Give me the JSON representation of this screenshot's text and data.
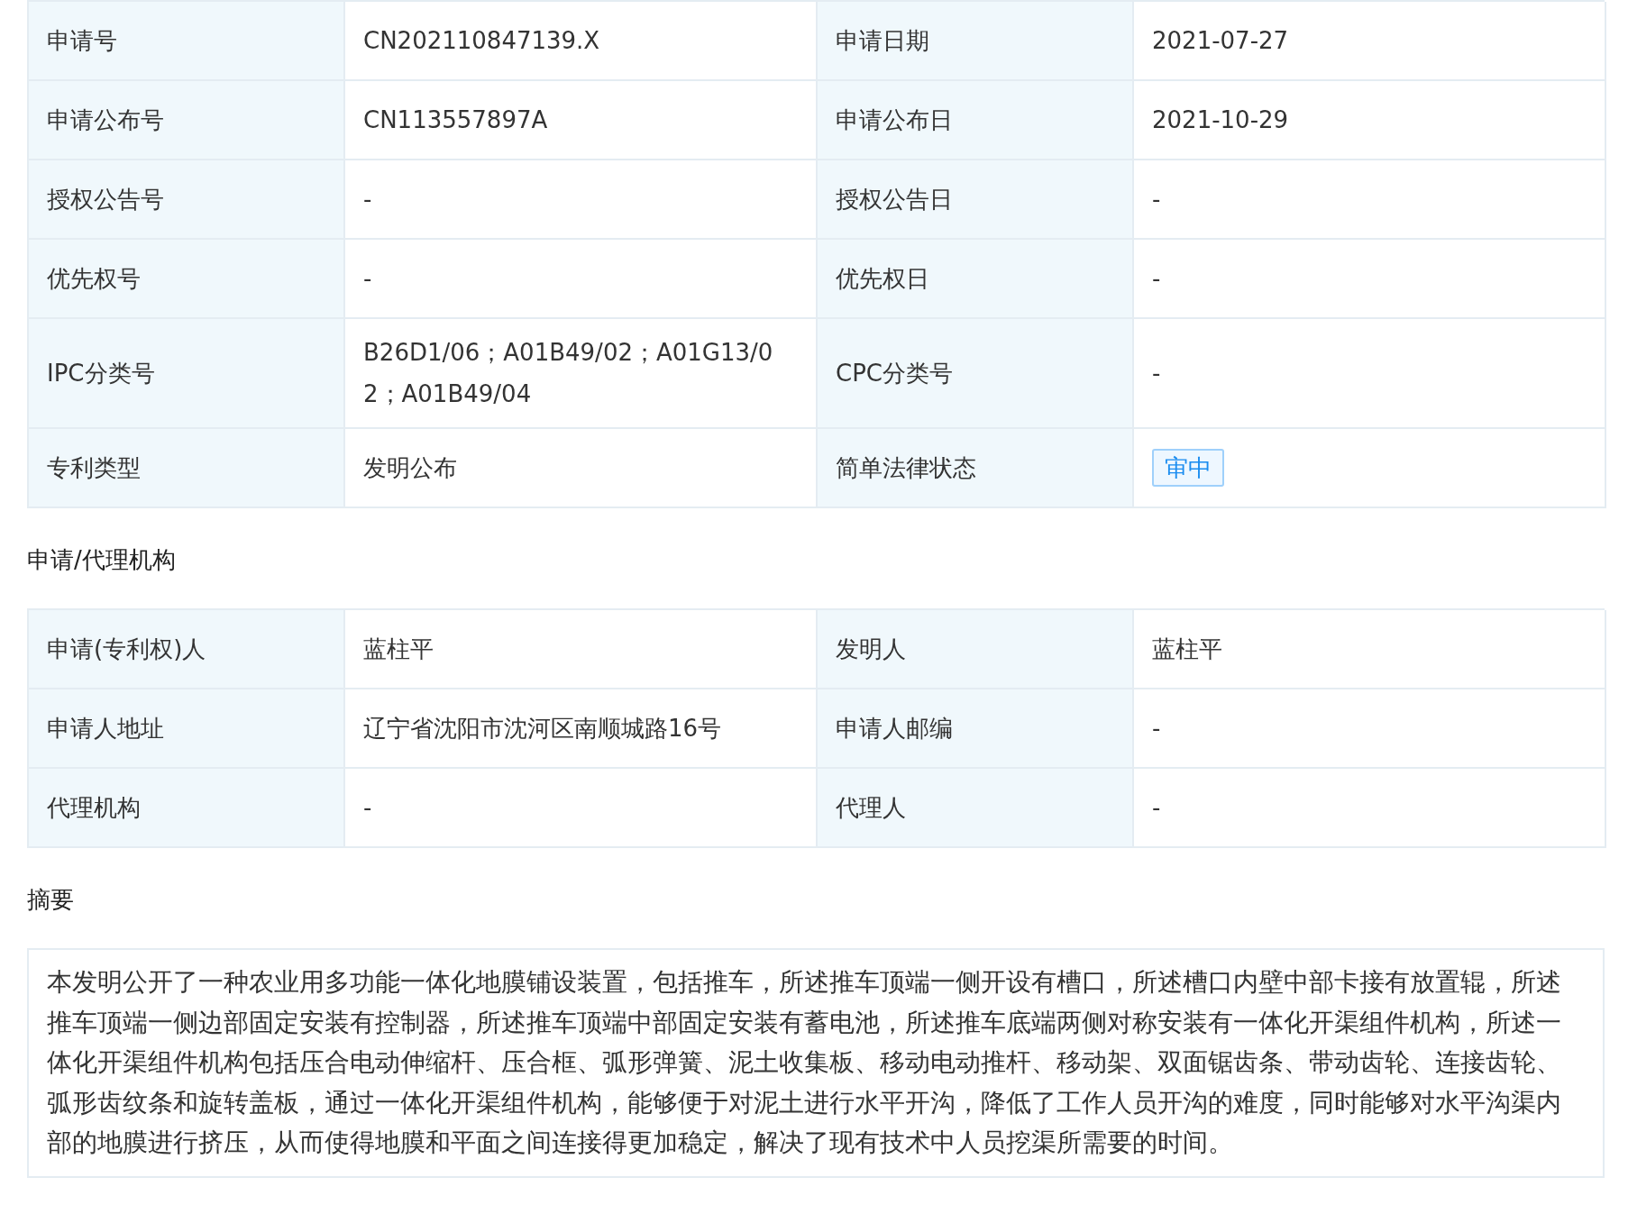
{
  "basic_info": {
    "rows": [
      {
        "cells": [
          {
            "label": "申请号",
            "value": "CN202110847139.X",
            "kind": "text"
          },
          {
            "label": "申请日期",
            "value": "2021-07-27",
            "kind": "text"
          }
        ]
      },
      {
        "cells": [
          {
            "label": "申请公布号",
            "value": "CN113557897A",
            "kind": "text"
          },
          {
            "label": "申请公布日",
            "value": "2021-10-29",
            "kind": "text"
          }
        ]
      },
      {
        "cells": [
          {
            "label": "授权公告号",
            "value": "-",
            "kind": "text"
          },
          {
            "label": "授权公告日",
            "value": "-",
            "kind": "text"
          }
        ]
      },
      {
        "cells": [
          {
            "label": "优先权号",
            "value": "-",
            "kind": "text"
          },
          {
            "label": "优先权日",
            "value": "-",
            "kind": "text"
          }
        ]
      },
      {
        "cells": [
          {
            "label": "IPC分类号",
            "value": "B26D1/06；A01B49/02；A01G13/02；A01B49/04",
            "kind": "text"
          },
          {
            "label": "CPC分类号",
            "value": "-",
            "kind": "text"
          }
        ]
      },
      {
        "cells": [
          {
            "label": "专利类型",
            "value": "发明公布",
            "kind": "text"
          },
          {
            "label": "简单法律状态",
            "value": "审中",
            "kind": "badge"
          }
        ]
      }
    ]
  },
  "agency": {
    "title": "申请/代理机构",
    "rows": [
      {
        "cells": [
          {
            "label": "申请(专利权)人",
            "value": "蓝柱平",
            "kind": "text"
          },
          {
            "label": "发明人",
            "value": "蓝柱平",
            "kind": "text"
          }
        ]
      },
      {
        "cells": [
          {
            "label": "申请人地址",
            "value": "辽宁省沈阳市沈河区南顺城路16号",
            "kind": "text"
          },
          {
            "label": "申请人邮编",
            "value": "-",
            "kind": "text"
          }
        ]
      },
      {
        "cells": [
          {
            "label": "代理机构",
            "value": "-",
            "kind": "text"
          },
          {
            "label": "代理人",
            "value": "-",
            "kind": "text"
          }
        ]
      }
    ]
  },
  "abstract": {
    "title": "摘要",
    "text": "本发明公开了一种农业用多功能一体化地膜铺设装置，包括推车，所述推车顶端一侧开设有槽口，所述槽口内壁中部卡接有放置辊，所述推车顶端一侧边部固定安装有控制器，所述推车顶端中部固定安装有蓄电池，所述推车底端两侧对称安装有一体化开渠组件机构，所述一体化开渠组件机构包括压合电动伸缩杆、压合框、弧形弹簧、泥土收集板、移动电动推杆、移动架、双面锯齿条、带动齿轮、连接齿轮、弧形齿纹条和旋转盖板，通过一体化开渠组件机构，能够便于对泥土进行水平开沟，降低了工作人员开沟的难度，同时能够对水平沟渠内部的地膜进行挤压，从而使得地膜和平面之间连接得更加稳定，解决了现有技术中人员挖渠所需要的时间。"
  }
}
